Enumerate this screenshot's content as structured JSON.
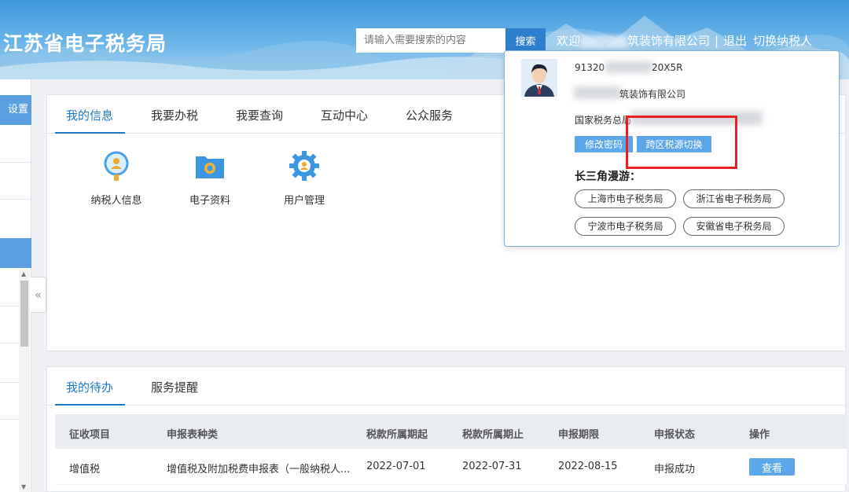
{
  "header": {
    "site_title": "江苏省电子税务局",
    "search_placeholder": "请输入需要搜索的内容",
    "search_button": "搜索",
    "welcome": "欢迎",
    "company_suffix": "筑装饰有限公司",
    "logout": "退出",
    "switch_taxpayer": "切换纳税人",
    "separator": "|"
  },
  "sidebar": {
    "head_label": "设置",
    "collapse_icon": "«"
  },
  "info_tabs": [
    {
      "label": "我的信息",
      "active": true
    },
    {
      "label": "我要办税",
      "active": false
    },
    {
      "label": "我要查询",
      "active": false
    },
    {
      "label": "互动中心",
      "active": false
    },
    {
      "label": "公众服务",
      "active": false
    }
  ],
  "apps": [
    {
      "label": "纳税人信息",
      "icon": "taxpayer-info-icon"
    },
    {
      "label": "电子资料",
      "icon": "folder-icon"
    },
    {
      "label": "用户管理",
      "icon": "gear-user-icon"
    }
  ],
  "todo_tabs": [
    {
      "label": "我的待办",
      "active": true
    },
    {
      "label": "服务提醒",
      "active": false
    }
  ],
  "table": {
    "headers": [
      "征收项目",
      "申报表种类",
      "税款所属期起",
      "税款所属期止",
      "申报期限",
      "申报状态",
      "操作"
    ],
    "rows": [
      [
        "增值税",
        "增值税及附加税费申报表（一般纳税人...",
        "2022-07-01",
        "2022-07-31",
        "2022-08-15",
        "申报成功",
        "查看"
      ]
    ]
  },
  "popup": {
    "tax_id_prefix": "91320",
    "tax_id_suffix": "20X5R",
    "company_suffix": "筑装饰有限公司",
    "bureau_prefix": "国家税务总局",
    "change_password": "修改密码",
    "cross_region_switch": "跨区税源切换",
    "yrd_title": "长三角漫游：",
    "regions": [
      "上海市电子税务局",
      "浙江省电子税务局",
      "宁波市电子税务局",
      "安徽省电子税务局"
    ]
  },
  "colors": {
    "accent": "#1f78c8",
    "button": "#5ba7ea",
    "highlight": "#e9201f",
    "header": "#3f98dc"
  }
}
